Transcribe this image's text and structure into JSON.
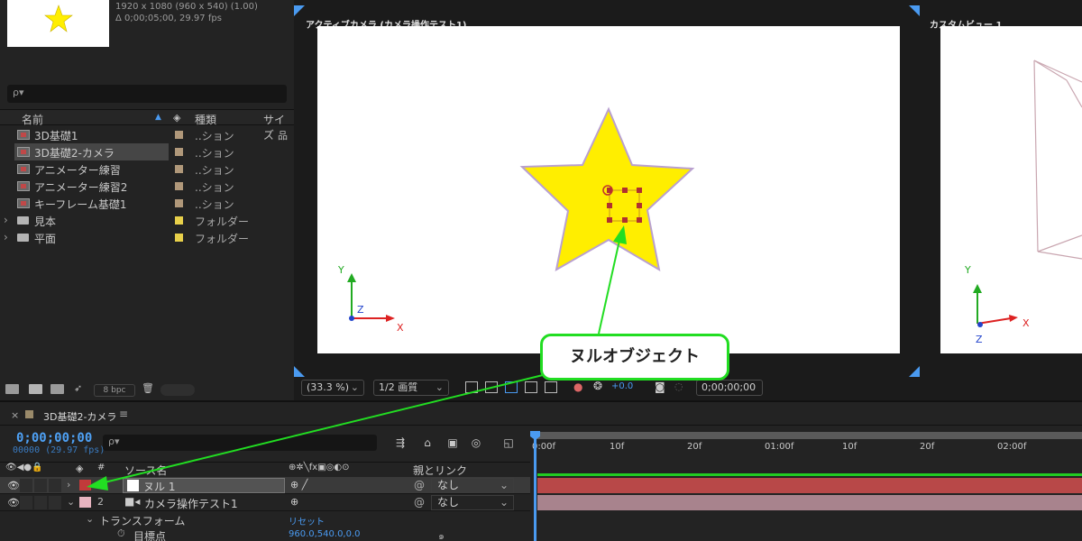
{
  "project": {
    "comp_info": {
      "resolution": "1920 x 1080  (960 x 540) (1.00)",
      "duration": "Δ 0;00;05;00, 29.97 fps"
    },
    "search_icon": "ρ▾",
    "columns": {
      "name": "名前",
      "type": "種類",
      "size": "サイズ"
    },
    "items": [
      {
        "name": "3D基礎1",
        "type": "..ション",
        "kind": "comp",
        "label_color": "#b0987a",
        "selected": false
      },
      {
        "name": "3D基礎2-カメラ",
        "type": "..ション",
        "kind": "comp",
        "label_color": "#b0987a",
        "selected": true
      },
      {
        "name": "アニメーター練習",
        "type": "..ション",
        "kind": "comp",
        "label_color": "#b0987a",
        "selected": false
      },
      {
        "name": "アニメーター練習2",
        "type": "..ション",
        "kind": "comp",
        "label_color": "#b0987a",
        "selected": false
      },
      {
        "name": "キーフレーム基礎1",
        "type": "..ション",
        "kind": "comp",
        "label_color": "#b0987a",
        "selected": false
      },
      {
        "name": "見本",
        "type": "フォルダー",
        "kind": "folder",
        "label_color": "#e8d04a",
        "selected": false
      },
      {
        "name": "平面",
        "type": "フォルダー",
        "kind": "folder",
        "label_color": "#e8d04a",
        "selected": false
      }
    ],
    "bpc": "8 bpc"
  },
  "viewer": {
    "title": "アクティブカメラ (カメラ操作テスト1)",
    "zoom": "(33.3 %)",
    "quality": "1/2 画質",
    "exposure": "+0.0",
    "timecode": "0;00;00;00",
    "axis": {
      "x": "X",
      "y": "Y",
      "z": "Z"
    }
  },
  "custom_view": {
    "title": "カスタムビュー 1",
    "axis": {
      "x": "X",
      "y": "Y",
      "z": "Z"
    }
  },
  "timeline": {
    "tab_label": "3D基礎2-カメラ",
    "close": "×",
    "menu": "≡",
    "timecode": "0;00;00;00",
    "timecode_sub": "00000 (29.97 fps)",
    "search_icon": "ρ▾",
    "columns": {
      "source_name": "ソース名",
      "parent": "親とリンク"
    },
    "ticks": [
      "0:00f",
      "10f",
      "20f",
      "01:00f",
      "10f",
      "20f",
      "02:00f"
    ],
    "layers": [
      {
        "num": "1",
        "name": "ヌル 1",
        "parent": "なし",
        "color": "#c23a3a",
        "bar_color": "#b84848",
        "selected": true
      },
      {
        "num": "2",
        "name": "カメラ操作テスト1",
        "parent": "なし",
        "color": "#e8b4c0",
        "bar_color": "#a8838d",
        "selected": false
      }
    ],
    "transform": {
      "label": "トランスフォーム",
      "reset": "リセット"
    },
    "property": {
      "label": "目標点",
      "value": "960.0,540.0,0.0"
    }
  },
  "callout": {
    "text": "ヌルオブジェクト",
    "color": "#22dd22"
  },
  "colors": {
    "accent_blue": "#4a9af0",
    "star_fill": "#ffee00",
    "star_stroke": "#b9a0d0"
  }
}
